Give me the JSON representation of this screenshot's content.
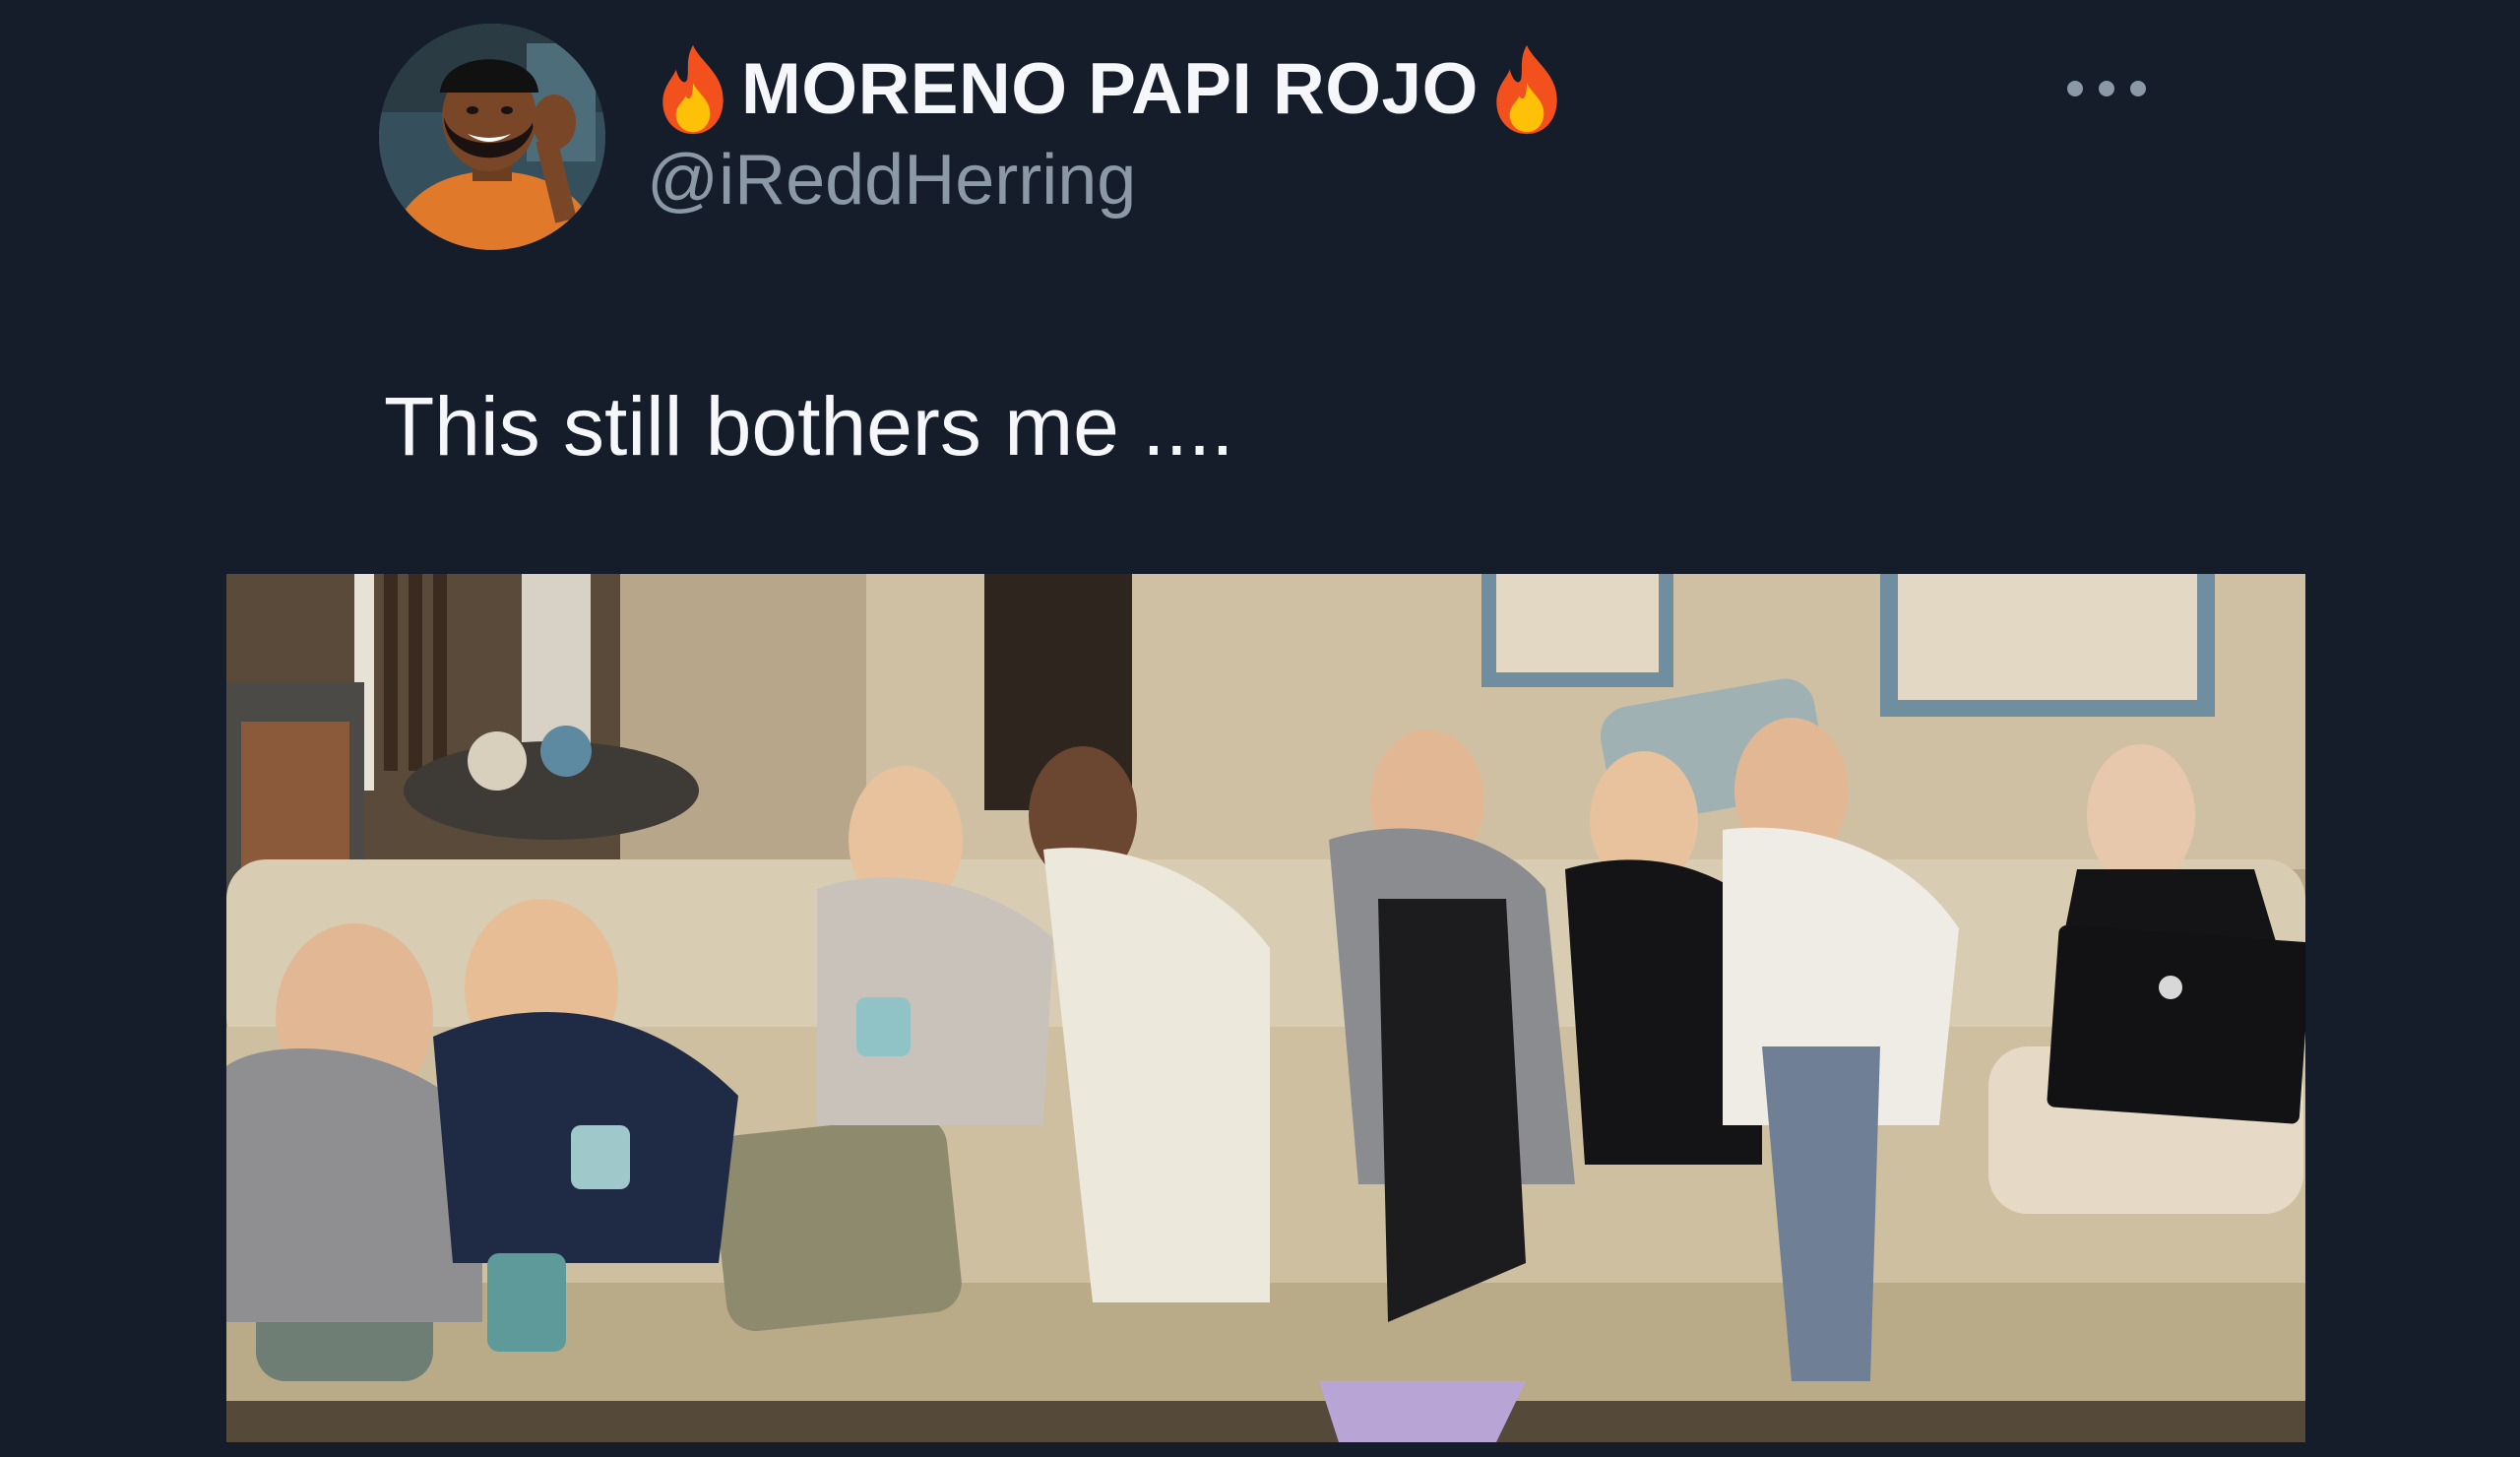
{
  "tweet": {
    "author": {
      "display_name": "MORENO PAPI ROJO",
      "handle": "@iReddHerring",
      "name_prefix_icon": "fire-icon",
      "name_suffix_icon": "fire-icon",
      "avatar_icon": "avatar-photo"
    },
    "more_icon": "more-horizontal-icon",
    "text": "This still bothers me ....",
    "media": {
      "kind": "photo",
      "icon": "photo-women-on-couch"
    }
  },
  "colors": {
    "background": "#151d2b",
    "name_text": "#f5f7fa",
    "handle_text": "#8b98a6",
    "body_text": "#f5f7fa"
  }
}
